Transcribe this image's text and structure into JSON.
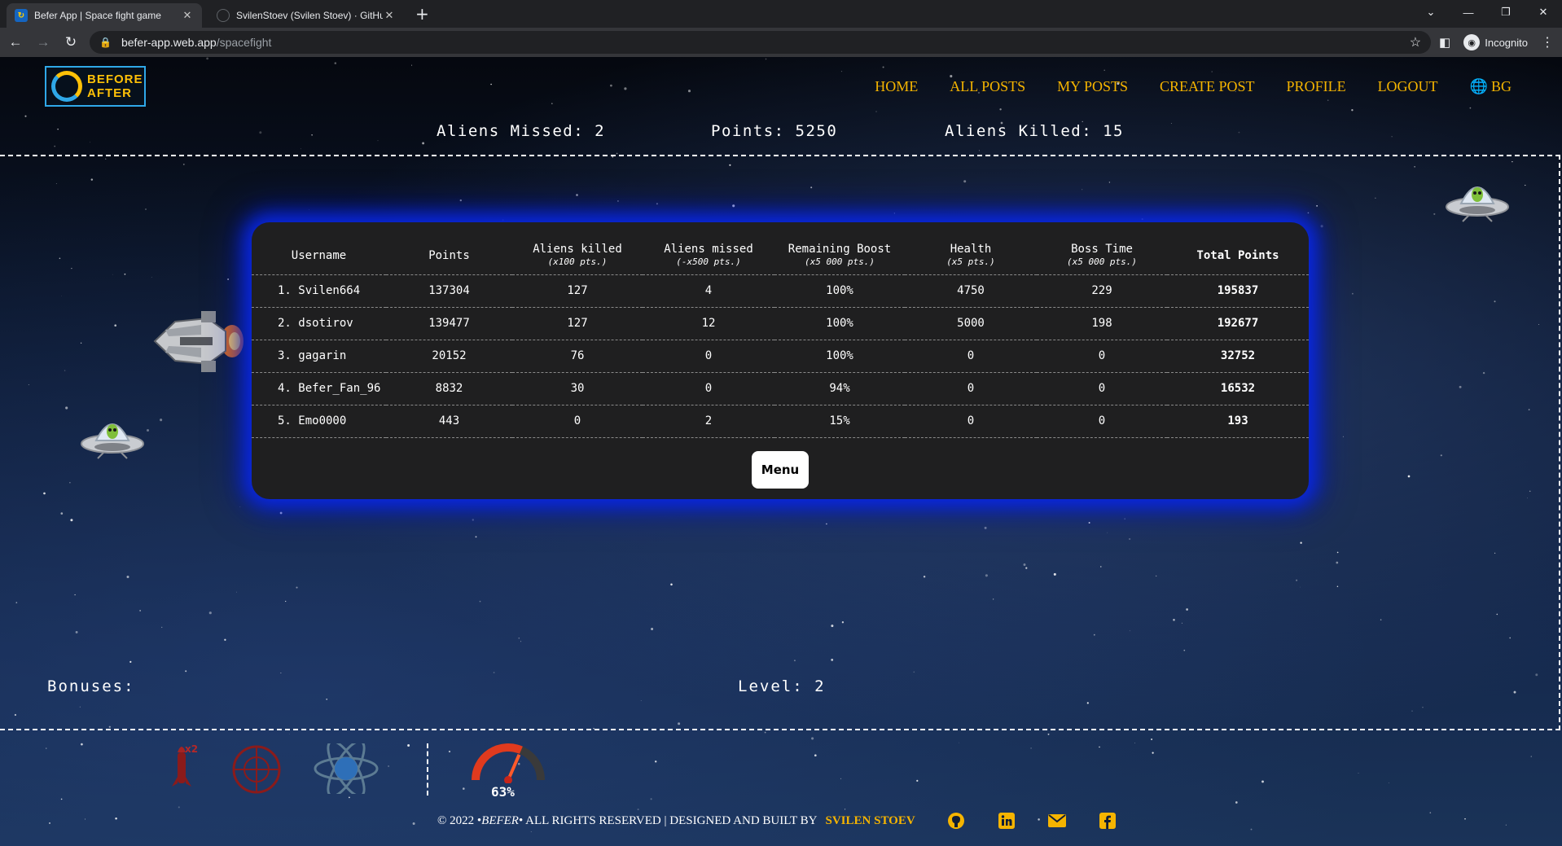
{
  "browser": {
    "tabs": [
      {
        "title": "Befer App | Space fight game",
        "active": true
      },
      {
        "title": "SvilenStoev (Svilen Stoev) · GitHub",
        "active": false
      }
    ],
    "url_host": "befer-app.web.app",
    "url_path": "/spacefight",
    "profile_label": "Incognito",
    "new_tab_symbol": "+",
    "window_controls": [
      "⌄",
      "—",
      "❐",
      "✕"
    ]
  },
  "site": {
    "logo_line1": "BEFORE",
    "logo_line2": "AFTER",
    "nav": [
      "HOME",
      "ALL POSTS",
      "MY POSTS",
      "CREATE POST",
      "PROFILE",
      "LOGOUT"
    ],
    "language": "BG"
  },
  "hud": {
    "aliens_missed": "Aliens Missed: 2",
    "points": "Points: 5250",
    "aliens_killed": "Aliens Killed: 15"
  },
  "leaderboard": {
    "columns": [
      {
        "label": "Username",
        "sub": ""
      },
      {
        "label": "Points",
        "sub": ""
      },
      {
        "label": "Aliens killed",
        "sub": "(x100 pts.)"
      },
      {
        "label": "Aliens missed",
        "sub": "(-x500 pts.)"
      },
      {
        "label": "Remaining Boost",
        "sub": "(x5 000 pts.)"
      },
      {
        "label": "Health",
        "sub": "(x5 pts.)"
      },
      {
        "label": "Boss Time",
        "sub": "(x5 000 pts.)"
      },
      {
        "label": "Total Points",
        "sub": ""
      }
    ],
    "rows": [
      [
        "1. Svilen664",
        "137304",
        "127",
        "4",
        "100%",
        "4750",
        "229",
        "195837"
      ],
      [
        "2. dsotirov",
        "139477",
        "127",
        "12",
        "100%",
        "5000",
        "198",
        "192677"
      ],
      [
        "3. gagarin",
        "20152",
        "76",
        "0",
        "100%",
        "0",
        "0",
        "32752"
      ],
      [
        "4. Befer_Fan_96",
        "8832",
        "30",
        "0",
        "94%",
        "0",
        "0",
        "16532"
      ],
      [
        "5. Emo0000",
        "443",
        "0",
        "2",
        "15%",
        "0",
        "0",
        "193"
      ]
    ],
    "menu_button": "Menu"
  },
  "bottom": {
    "bonuses_label": "Bonuses:",
    "bonus_badge": "x2",
    "boost_percent": "63%",
    "boost_level": 0.63,
    "level": "Level: 2"
  },
  "footer": {
    "copyright_prefix": "© 2022 • ",
    "brand": "BEFER",
    "rights": " • ALL RIGHTS RESERVED | DESIGNED AND BUILT BY ",
    "author": "SVILEN STOEV",
    "social_icons": [
      "github-icon",
      "linkedin-icon",
      "mail-icon",
      "facebook-icon"
    ]
  },
  "colors": {
    "accent": "#f5b400",
    "board_glow": "#0a28e6",
    "board_bg": "#1f1f20"
  }
}
